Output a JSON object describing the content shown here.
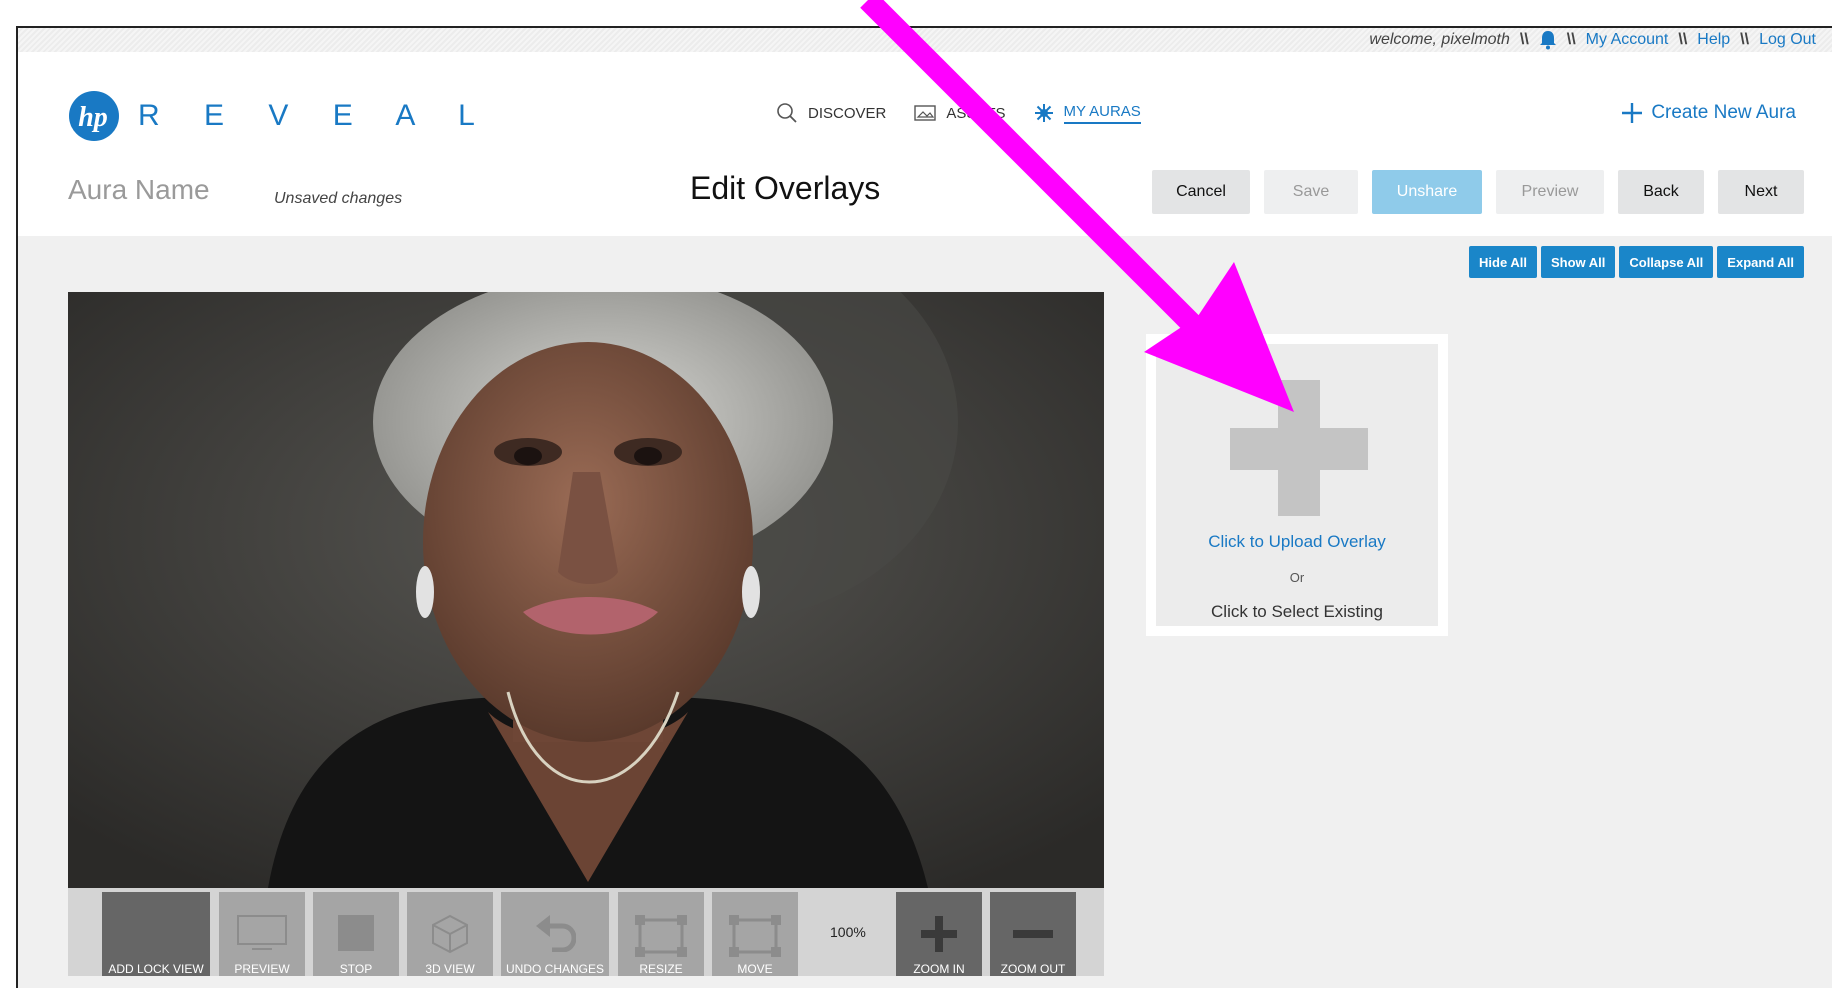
{
  "topnav": {
    "welcome": "welcome, pixelmoth",
    "sep": "\\\\",
    "my_account": "My Account",
    "help": "Help",
    "log_out": "Log Out"
  },
  "brand": {
    "logo_text": "hp",
    "name": "R E V E A L"
  },
  "mainnav": {
    "discover": "DISCOVER",
    "assets": "ASSETS",
    "my_auras": "MY AURAS"
  },
  "create_new_aura": "Create New Aura",
  "title_bar": {
    "aura_name": "Aura Name",
    "unsaved": "Unsaved changes",
    "page_title": "Edit Overlays"
  },
  "actions": {
    "cancel": "Cancel",
    "save": "Save",
    "unshare": "Unshare",
    "preview": "Preview",
    "back": "Back",
    "next": "Next"
  },
  "view_controls": {
    "hide_all": "Hide All",
    "show_all": "Show All",
    "collapse_all": "Collapse All",
    "expand_all": "Expand All"
  },
  "toolbar": {
    "add_lock_view": "ADD LOCK VIEW",
    "preview": "PREVIEW",
    "stop": "STOP",
    "view_3d": "3D VIEW",
    "undo_changes": "UNDO CHANGES",
    "resize": "RESIZE",
    "move": "MOVE",
    "zoom_level": "100%",
    "zoom_in": "ZOOM IN",
    "zoom_out": "ZOOM OUT"
  },
  "upload": {
    "upload_link": "Click to Upload Overlay",
    "or": "Or",
    "select_existing": "Click to Select Existing"
  },
  "colors": {
    "accent": "#1979c4",
    "button_blue": "#1a86c9",
    "annotation_arrow": "#ff00ff"
  }
}
